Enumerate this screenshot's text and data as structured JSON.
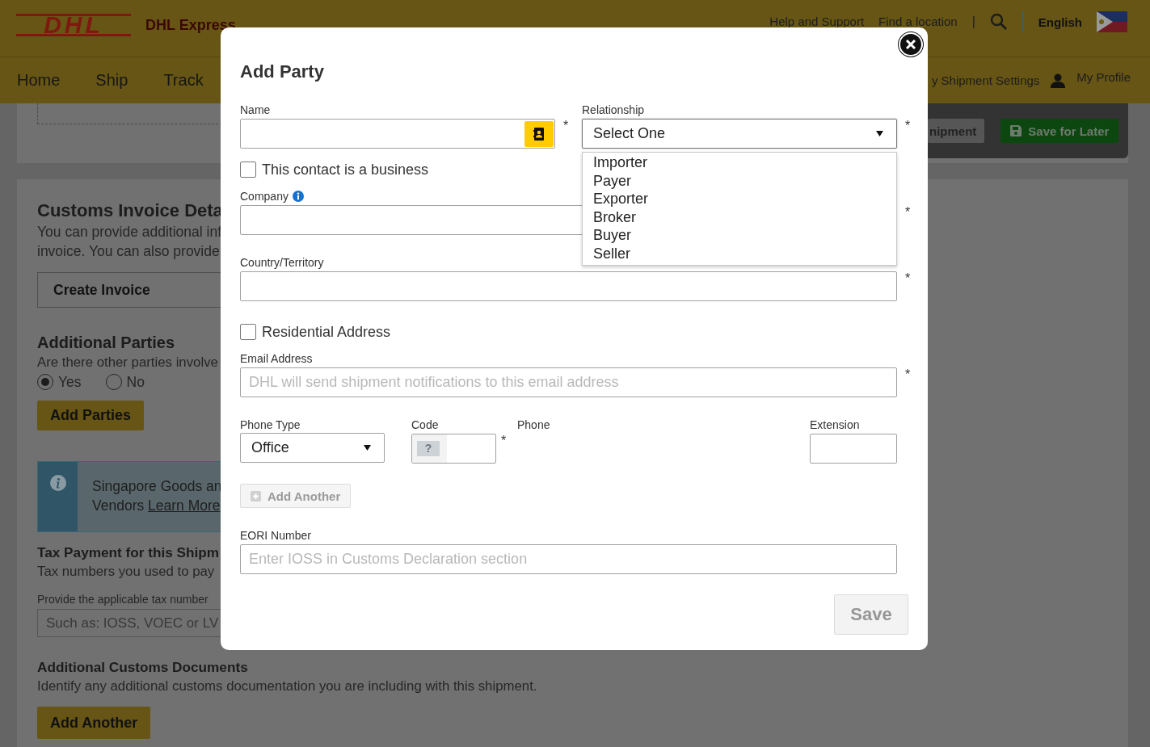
{
  "header": {
    "logo": "DHL",
    "brand": "DHL Express",
    "links": [
      "Help and Support",
      "Find a location"
    ],
    "separator": "|",
    "language": "English"
  },
  "nav": {
    "items": [
      "Home",
      "Ship",
      "Track"
    ],
    "settings": "y Shipment Settings",
    "profile": "My Profile"
  },
  "top_panel": {
    "buttons": [
      {
        "label": "nipment",
        "kind": "secondary"
      },
      {
        "label": "Save for Later",
        "kind": "save"
      }
    ]
  },
  "customs_invoice": {
    "title": "Customs Invoice Deta",
    "lines": [
      "You can provide additional inf",
      "invoice. You can also provide"
    ],
    "button": "Create Invoice"
  },
  "additional_parties": {
    "title": "Additional Parties",
    "question": "Are there other parties involve",
    "options": [
      {
        "label": "Yes",
        "selected": true
      },
      {
        "label": "No",
        "selected": false
      }
    ],
    "button": "Add Parties"
  },
  "info_box": {
    "line1": "Singapore Goods an",
    "line2": "Vendors ",
    "link": "Learn More"
  },
  "tax_payment": {
    "title": "Tax Payment for this Shipm",
    "text": "Tax numbers you used to pay",
    "field_label": "Provide the applicable tax number",
    "placeholder": "Such as: IOSS, VOEC or LV"
  },
  "customs_documents": {
    "title": "Additional Customs Documents",
    "text": "Identify any additional customs documentation you are including with this shipment.",
    "button": "Add Another"
  },
  "modal": {
    "title": "Add Party",
    "name": {
      "label": "Name",
      "required_mark": "*"
    },
    "relationship": {
      "label": "Relationship",
      "value": "Select One",
      "required_mark": "*",
      "expanded": true,
      "options": [
        {
          "label": "Importer",
          "selected": false
        },
        {
          "label": "Payer",
          "selected": false
        },
        {
          "label": "Exporter",
          "selected": false
        },
        {
          "label": "Broker",
          "selected": false
        },
        {
          "label": "Buyer",
          "selected": false
        },
        {
          "label": "Seller",
          "selected": false
        }
      ]
    },
    "business_checkbox": {
      "label": "This contact is a business",
      "checked": false
    },
    "company": {
      "label": "Company",
      "required_mark": "*"
    },
    "country": {
      "label": "Country/Territory",
      "required_mark": "*"
    },
    "residential_checkbox": {
      "label": "Residential Address",
      "checked": false
    },
    "email": {
      "label": "Email Address",
      "placeholder": "DHL will send shipment notifications to this email address",
      "required_mark": "*"
    },
    "phone_type": {
      "label": "Phone Type",
      "value": "Office"
    },
    "code": {
      "label": "Code",
      "flag": "?",
      "required_mark": "*"
    },
    "phone": {
      "label": "Phone"
    },
    "extension": {
      "label": "Extension"
    },
    "add_another": {
      "label": "Add Another",
      "disabled": true
    },
    "eori": {
      "label": "EORI Number",
      "placeholder": "Enter IOSS in Customs Declaration section"
    },
    "save": {
      "label": "Save",
      "disabled": true
    }
  }
}
